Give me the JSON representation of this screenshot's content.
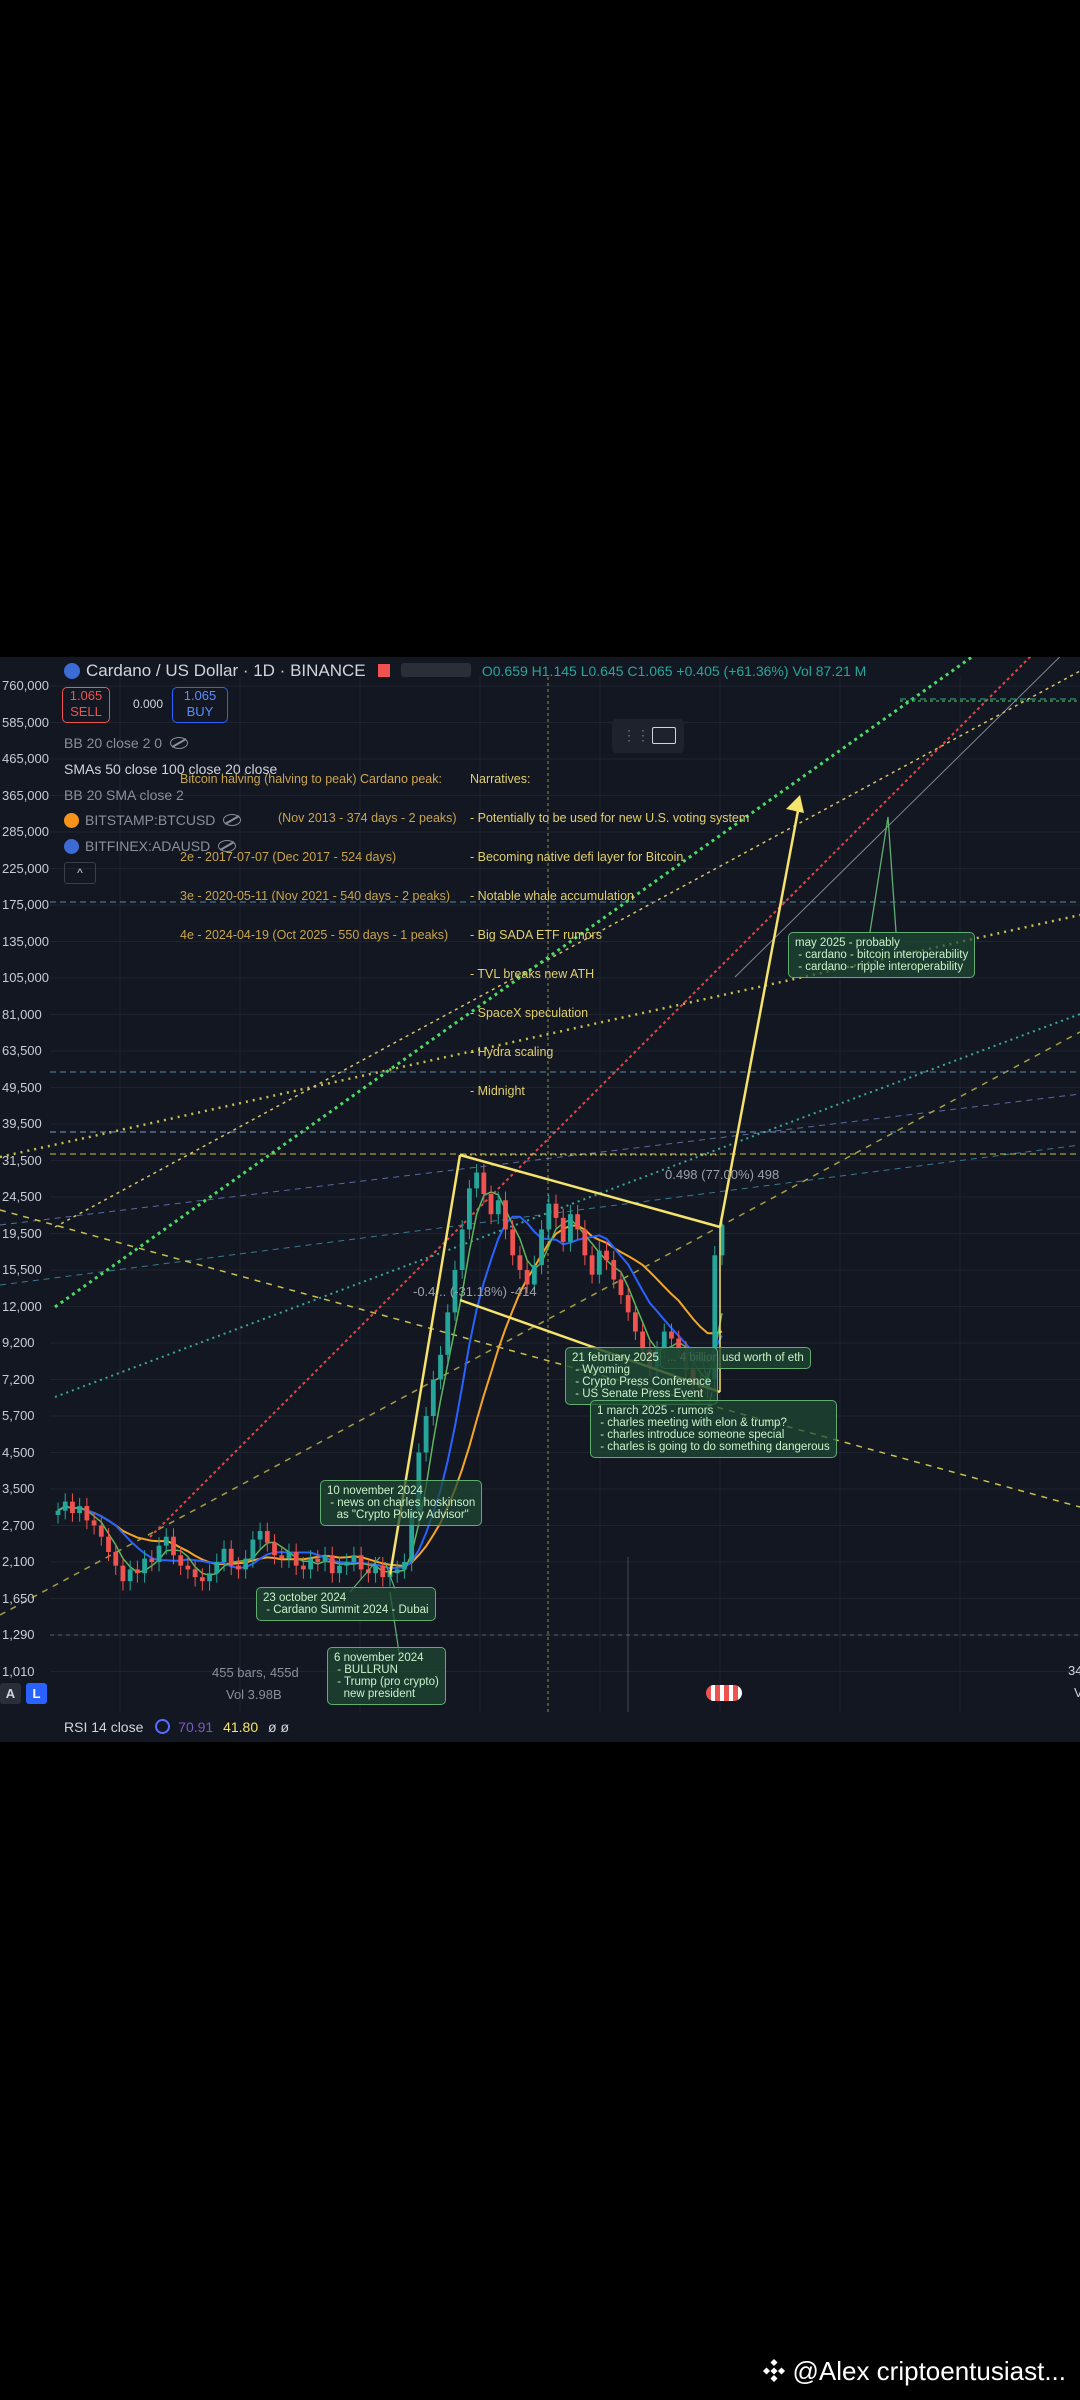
{
  "header": {
    "symbol": "Cardano / US Dollar · 1D · BINANCE",
    "ohlc": "O0.659 H1.145 L0.645 C1.065 +0.405 (+61.36%) Vol 87.21 M"
  },
  "trade": {
    "sell_price": "1.065",
    "sell_label": "SELL",
    "spread": "0.000",
    "buy_price": "1.065",
    "buy_label": "BUY"
  },
  "indicators": {
    "bb1": "BB 20 close 2 0",
    "smas": "SMAs 50 close 100 close 20 close",
    "bb2": "BB 20 SMA close 2",
    "btc_pair": "BITSTAMP:BTCUSD",
    "ada_pair": "BITFINEX:ADAUSD",
    "collapse_symbol": "^"
  },
  "halving_box": {
    "title": "Bitcoin halving (halving to peak)",
    "rows": [
      "2e - 2017-07-07 (Dec 2017 - 524 days)",
      "3e - 2020-05-11 (Nov 2021 - 540 days - 2 peaks)",
      "4e - 2024-04-19 (Oct 2025 - 550 days - 1 peaks)"
    ],
    "cardano_title": "Cardano peak:",
    "first_row": "(Nov 2013 - 374 days - 2 peaks)"
  },
  "narratives": {
    "title": "Narratives:",
    "items": [
      "- Potentially to be used for new U.S. voting system",
      "- Becoming native defi layer for Bitcoin",
      "- Notable whale accumulation",
      "- Big SADA ETF rumors",
      "- TVL breaks new ATH",
      "- SpaceX speculation",
      "- Hydra scaling",
      "- Midnight"
    ]
  },
  "callouts": {
    "may2025": "may 2025 - probably\n - cardano - bitcoin interoperability\n - cardano - ripple interoperability",
    "nov10": "10 november 2024\n - news on charles hoskinson\n   as \"Crypto Policy Advisor\"",
    "oct23": "23 october 2024\n - Cardano Summit 2024 - Dubai",
    "nov6": "6 november 2024\n - BULLRUN\n - Trump (pro crypto)\n   new president",
    "feb21": "21 february 2025\n - Wyoming\n - Crypto Press Conference\n - US Senate Press Event",
    "eth": "... 4 billion usd worth of eth",
    "mar1": "1 march 2025 - rumors\n - charles meeting with elon & trump?\n - charles introduce someone special\n - charles is going to do something dangerous"
  },
  "chart_labels": {
    "fib_upper": "0.498 (77.00%) 498",
    "fib_lower": "-0.4... (-31.18%) -414",
    "bars_info": "455 bars, 455d",
    "vol_info": "Vol 3.98B",
    "right_partial_top": "34",
    "right_partial_bottom": "V",
    "badge_a": "A",
    "badge_l": "L"
  },
  "rsi": {
    "label": "RSI 14 close",
    "value1": "70.91",
    "value2": "41.80",
    "extra": "ø ø"
  },
  "watermark": {
    "text": "@Alex criptoentusiast..."
  },
  "colors": {
    "panel_bg": "#131722",
    "up_candle": "#26a69a",
    "down_candle": "#ef5350",
    "yellow": "#f5e36b",
    "green_note": "#5fae6f",
    "blue_sma": "#2962ff",
    "orange_sma": "#f6a623"
  },
  "chart_data": {
    "type": "line",
    "scale": "log",
    "y_tick_labels": [
      "760,000",
      "585,000",
      "465,000",
      "365,000",
      "285,000",
      "225,000",
      "175,000",
      "135,000",
      "105,000",
      "81,000",
      "63,500",
      "49,500",
      "39,500",
      "31,500",
      "24,500",
      "19,500",
      "15,500",
      "12,000",
      "9,200",
      "7,200",
      "5,700",
      "4,500",
      "3,500",
      "2,700",
      "2,100",
      "1,650",
      "1,290",
      "1,010"
    ],
    "series": [
      {
        "values": [
          3000,
          3200,
          2950,
          3100,
          2800,
          2700,
          2500,
          2250,
          2050,
          1850,
          2000,
          1950,
          2150,
          2100,
          2350,
          2500,
          2200,
          2050,
          2000,
          1900,
          1850,
          1950,
          2100,
          2300,
          2050,
          2000,
          2150,
          2450,
          2600,
          2400,
          2200,
          2150,
          2250,
          2050,
          2000,
          2150,
          2100,
          2200,
          1950,
          2050,
          2100,
          2200,
          2000,
          1950,
          2050,
          1900,
          1950,
          2000,
          2100,
          3000,
          4500,
          5700,
          7200,
          8500,
          11500,
          15500,
          20000,
          26000,
          29000,
          25000,
          22000,
          24000,
          20000,
          17000,
          15500,
          14000,
          16000,
          20000,
          23500,
          21500,
          18500,
          22000,
          20000,
          17000,
          15000,
          17500,
          16500,
          14500,
          13000,
          11500,
          10000,
          8800,
          7800,
          8800,
          10000,
          9500,
          8800,
          7700,
          7000,
          6800,
          7200,
          17000,
          20500
        ]
      }
    ]
  }
}
